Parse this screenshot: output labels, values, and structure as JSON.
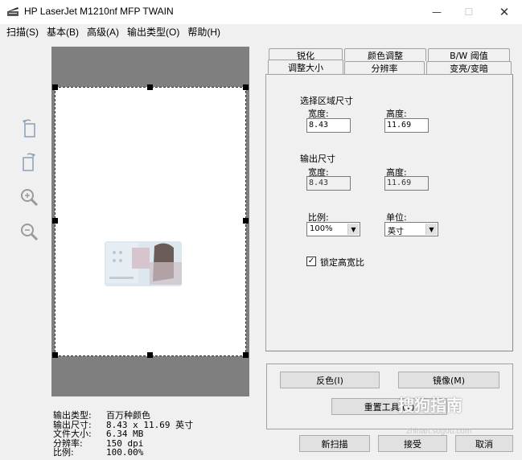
{
  "window": {
    "title": "HP LaserJet M1210nf MFP TWAIN"
  },
  "menu": [
    {
      "label": "扫描(S)"
    },
    {
      "label": "基本(B)"
    },
    {
      "label": "高级(A)"
    },
    {
      "label": "输出类型(O)"
    },
    {
      "label": "帮助(H)"
    }
  ],
  "tools": [
    "rotate-left-icon",
    "rotate-right-icon",
    "zoom-in-icon",
    "zoom-out-icon"
  ],
  "tabs": {
    "row1": [
      "锐化",
      "颜色调整",
      "B/W 阈值"
    ],
    "row2": [
      "调整大小",
      "分辨率",
      "变亮/变暗"
    ]
  },
  "panel": {
    "select_area_title": "选择区域尺寸",
    "width_label": "宽度:",
    "height_label": "高度:",
    "select_width": "8.43",
    "select_height": "11.69",
    "output_title": "输出尺寸",
    "output_width": "8.43",
    "output_height": "11.69",
    "scale_label": "比例:",
    "unit_label": "单位:",
    "scale_value": "100%",
    "unit_value": "英寸",
    "lock_label": "锁定高宽比",
    "lock_checked": true
  },
  "buttons": {
    "invert": "反色(I)",
    "mirror": "镜像(M)",
    "reset": "重置工具 (T)",
    "rescan": "新扫描",
    "accept": "接受",
    "cancel": "取消"
  },
  "info": {
    "type_label": "输出类型:",
    "type_value": "百万种颜色",
    "size_label": "输出尺寸:",
    "size_value": "8.43 x 11.69 英寸",
    "file_label": "文件大小:",
    "file_value": "6.34 MB",
    "res_label": "分辨率:",
    "res_value": "150 dpi",
    "ratio_label": "比例:",
    "ratio_value": "100.00%"
  },
  "watermark": {
    "text": "搜狗指南",
    "sub": "zhinan.sogou.com"
  }
}
